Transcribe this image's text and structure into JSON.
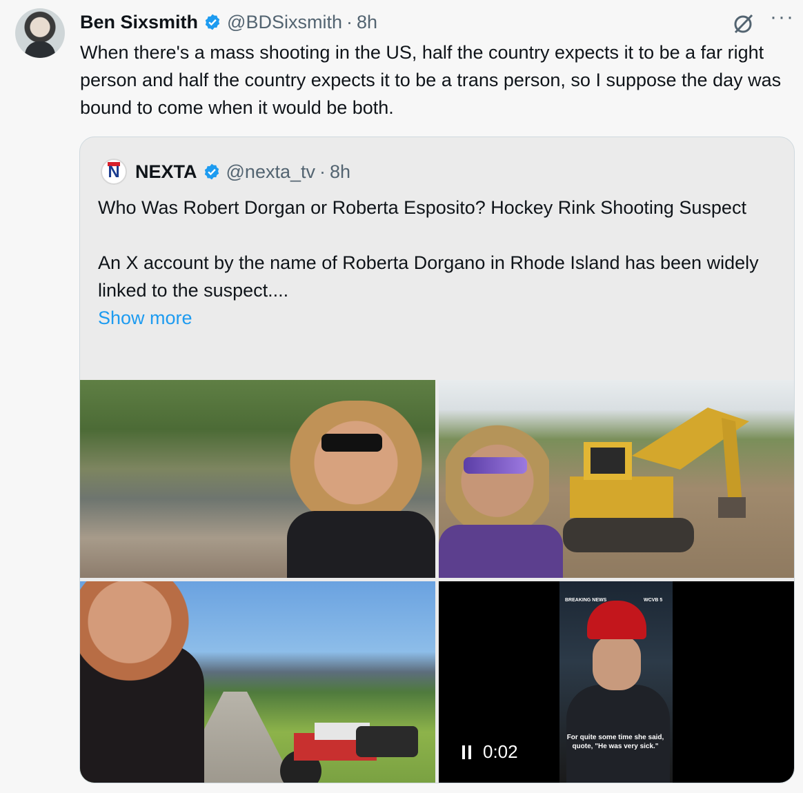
{
  "tweet": {
    "author_name": "Ben Sixsmith",
    "handle": "@BDSixsmith",
    "separator": "·",
    "time": "8h",
    "more_label": "···",
    "text": "When there's a mass shooting in the US, half the country expects it to be a far right person and half the country expects it to be a trans person, so I suppose the day was bound to come when it would be both."
  },
  "quote": {
    "author_name": "NEXTA",
    "handle": "@nexta_tv",
    "separator": "·",
    "time": "8h",
    "logo_letter": "N",
    "paragraph1": "Who Was Robert Dorgan or Roberta Esposito? Hockey Rink Shooting Suspect",
    "paragraph2": "An X account by the name of Roberta Dorgano in Rhode Island has been widely linked to the suspect....",
    "show_more": "Show more"
  },
  "video": {
    "elapsed": "0:02",
    "caption": "For quite some time she said, quote, \"He was very sick.\"",
    "tag_left": "BREAKING NEWS",
    "tag_right": "WCVB 5"
  },
  "colors": {
    "link": "#1d9bf0",
    "verified": "#1d9bf0",
    "secondary_text": "#536471"
  }
}
